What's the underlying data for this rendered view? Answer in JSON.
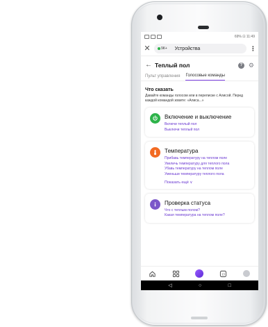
{
  "status_bar": {
    "left_icons": [
      "signal-icon",
      "wifi-icon",
      "notification-icon"
    ],
    "right_text": "69% ⊡ 11:49"
  },
  "browser": {
    "close_icon": "close-icon",
    "security_label": "9К+",
    "page_title": "Устройства",
    "menu_icon": "kebab-menu-icon"
  },
  "header": {
    "title": "Теплый пол",
    "help_icon": "help-icon",
    "settings_icon": "gear-icon"
  },
  "tabs": [
    {
      "label": "Пульт управления",
      "active": false
    },
    {
      "label": "Голосовые команды",
      "active": true
    }
  ],
  "section": {
    "title": "Что сказать",
    "subtitle": "Давайте команды голосом или в переписке с Алисой. Перед каждой командой зовите: «Алиса...»"
  },
  "cards": [
    {
      "title": "Включение и выключение",
      "icon": "power-icon",
      "icon_color": "#2db34a",
      "commands": [
        "Включи теплый пол",
        "Выключи теплый пол"
      ],
      "more": ""
    },
    {
      "title": "Температура",
      "icon": "thermometer-icon",
      "icon_color": "#f26a22",
      "commands": [
        "Прибавь температуру на теплом поле",
        "Увеличь температуру для теплого пола",
        "Убавь температуру на теплом поле",
        "Уменьши температуру теплого пола"
      ],
      "more": "Показать ещё"
    },
    {
      "title": "Проверка статуса",
      "icon": "info-icon",
      "icon_color": "#7b58c9",
      "commands": [
        "Что с теплым полом?",
        "Какая температура на теплом поле?"
      ],
      "more": ""
    }
  ],
  "bottom_nav": {
    "items": [
      "home-icon",
      "services-icon",
      "alice-icon",
      "tabs-icon",
      "profile-icon"
    ],
    "tabs_count": "13"
  },
  "colors": {
    "accent": "#6a38d1",
    "tab_underline": "#7b3fe4"
  }
}
